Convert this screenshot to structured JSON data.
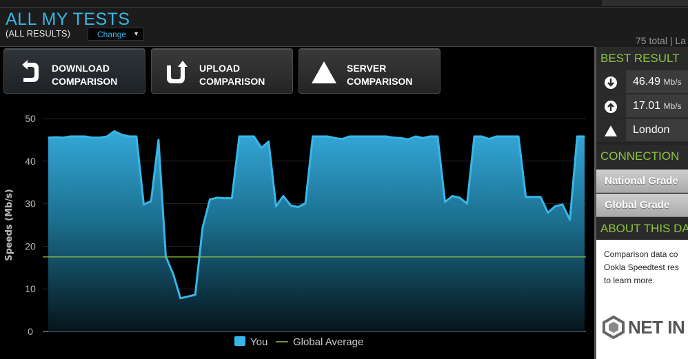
{
  "header": {
    "title": "ALL MY TESTS",
    "subtitle": "(ALL RESULTS)",
    "change_label": "Change",
    "totals": "75 total | La"
  },
  "tabs": [
    {
      "line1": "DOWNLOAD",
      "line2": "COMPARISON",
      "icon": "download-icon"
    },
    {
      "line1": "UPLOAD",
      "line2": "COMPARISON",
      "icon": "upload-icon"
    },
    {
      "line1": "SERVER",
      "line2": "COMPARISON",
      "icon": "server-triangle-icon"
    }
  ],
  "sidebar": {
    "best_result_title": "BEST RESULT",
    "best": [
      {
        "icon": "download-arrow-icon",
        "value": "46.49",
        "unit": "Mb/s"
      },
      {
        "icon": "upload-arrow-icon",
        "value": "17.01",
        "unit": "Mb/s"
      },
      {
        "icon": "server-triangle-icon",
        "value": "London",
        "unit": ""
      }
    ],
    "connection_title": "CONNECTION",
    "grades": [
      "National Grade",
      "Global Grade"
    ],
    "about_title": "ABOUT THIS DA",
    "about_lines": [
      "Comparison data co",
      "Ookla Speedtest res",
      "to learn more."
    ],
    "logo_text": "NET IN"
  },
  "colors": {
    "accent_blue": "#38b6e8",
    "green": "#8dc63f",
    "average_line": "#8dc63f"
  },
  "chart_data": {
    "type": "area",
    "ylabel": "Speeds (Mb/s)",
    "ylim": [
      0,
      50
    ],
    "yticks": [
      0,
      10,
      20,
      30,
      40,
      50
    ],
    "grid": true,
    "legend_position": "bottom",
    "series": [
      {
        "name": "You",
        "color": "#38b6e8",
        "values": [
          45.5,
          45.6,
          45.5,
          45.8,
          45.8,
          45.8,
          45.5,
          45.5,
          45.8,
          47.0,
          46.2,
          45.8,
          45.8,
          29.8,
          30.6,
          45.0,
          17.6,
          13.5,
          7.8,
          8.2,
          8.6,
          24.3,
          31.0,
          31.4,
          31.3,
          31.3,
          45.8,
          45.8,
          45.8,
          43.1,
          44.6,
          29.4,
          31.8,
          29.6,
          29.2,
          30.1,
          45.8,
          45.8,
          45.8,
          45.4,
          45.2,
          45.8,
          45.8,
          45.8,
          45.8,
          45.8,
          45.8,
          45.5,
          45.4,
          45.1,
          45.8,
          45.4,
          45.8,
          45.8,
          30.4,
          31.8,
          31.4,
          30.0,
          45.8,
          45.8,
          45.2,
          45.8,
          45.8,
          45.8,
          45.8,
          31.6,
          31.6,
          31.6,
          27.9,
          29.4,
          29.8,
          26.2,
          45.8,
          45.8
        ]
      },
      {
        "name": "Global Average",
        "color": "#8dc63f",
        "values": [
          17.5
        ]
      }
    ]
  }
}
